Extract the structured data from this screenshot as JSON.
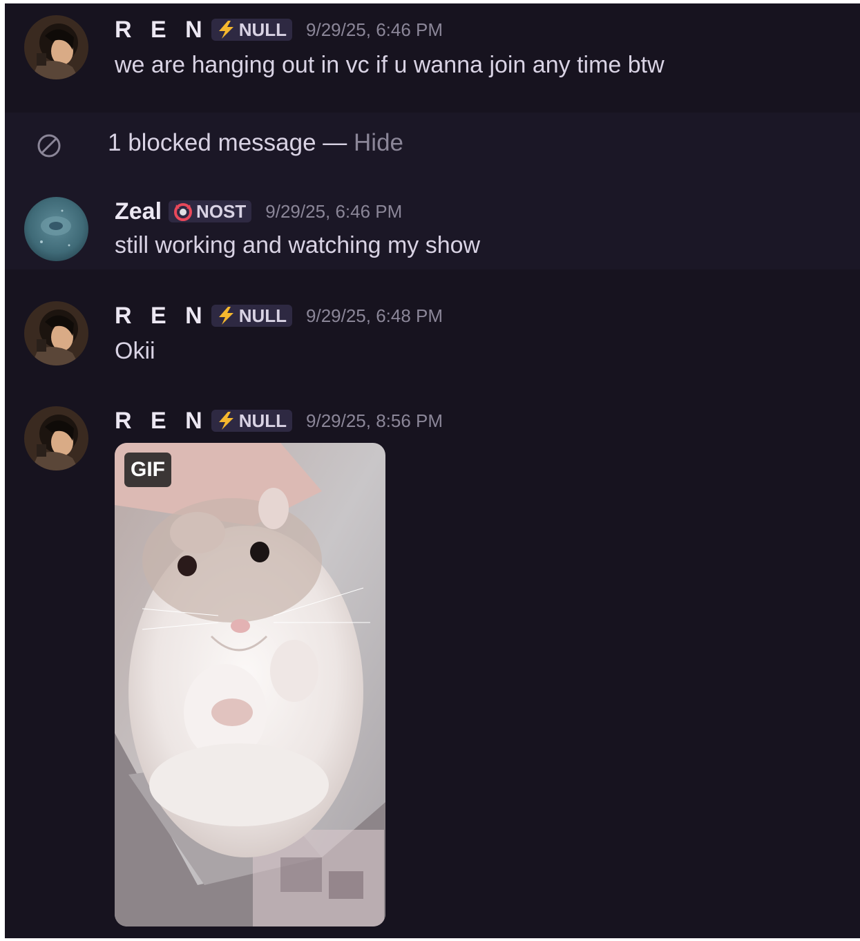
{
  "messages": [
    {
      "username": "R E N",
      "tag": "NULL",
      "tag_icon": "lightning-bolt-icon",
      "timestamp": "9/29/25, 6:46 PM",
      "text": "we are hanging out in vc if u wanna join any time btw"
    },
    {
      "username": "Zeal",
      "tag": "NOST",
      "tag_icon": "horned-ring-icon",
      "timestamp": "9/29/25, 6:46 PM",
      "text": "still working and watching my show"
    },
    {
      "username": "R E N",
      "tag": "NULL",
      "tag_icon": "lightning-bolt-icon",
      "timestamp": "9/29/25, 6:48 PM",
      "text": "Okii"
    },
    {
      "username": "R E N",
      "tag": "NULL",
      "tag_icon": "lightning-bolt-icon",
      "timestamp": "9/29/25, 8:56 PM",
      "attachment_badge": "GIF"
    }
  ],
  "blocked": {
    "icon": "blocked-circle-icon",
    "label": "1 blocked message — ",
    "action": "Hide"
  },
  "colors": {
    "background": "#17131f",
    "highlight_row": "#1b1726",
    "text": "#d9d3e4",
    "muted": "#8b8698",
    "tag_bg": "#2e2942",
    "bolt": "#f5b82e"
  }
}
